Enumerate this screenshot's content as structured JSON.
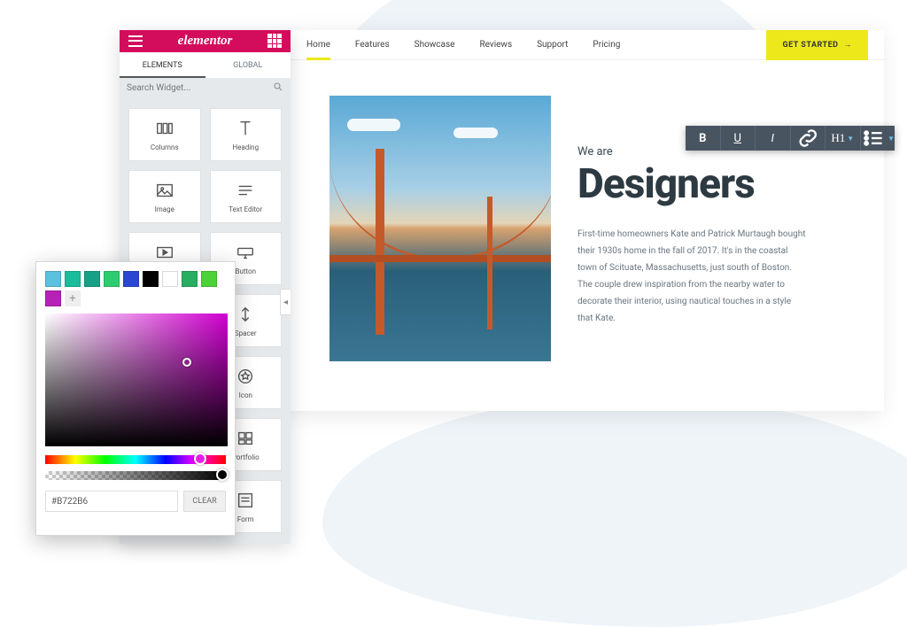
{
  "panel": {
    "brand": "elementor",
    "tabs": {
      "elements": "ELEMENTS",
      "global": "GLOBAL"
    },
    "search": {
      "placeholder": "Search Widget..."
    },
    "widgets": [
      {
        "key": "columns",
        "label": "Columns"
      },
      {
        "key": "heading",
        "label": "Heading"
      },
      {
        "key": "image",
        "label": "Image"
      },
      {
        "key": "text-editor",
        "label": "Text Editor"
      },
      {
        "key": "video",
        "label": "Video"
      },
      {
        "key": "button",
        "label": "Button"
      },
      {
        "key": "spacer",
        "label": "Spacer"
      },
      {
        "key": "icon",
        "label": "Icon"
      },
      {
        "key": "portfolio",
        "label": "Portfolio"
      },
      {
        "key": "form",
        "label": "Form"
      }
    ]
  },
  "preview": {
    "nav": [
      "Home",
      "Features",
      "Showcase",
      "Reviews",
      "Support",
      "Pricing"
    ],
    "cta": "GET STARTED",
    "subheading": "We are",
    "heading": "Designers",
    "paragraph": "First-time homeowners Kate and Patrick Murtaugh bought their 1930s home in the fall of 2017. It's in the coastal town of Scituate, Massachusetts, just south of Boston. The couple drew inspiration from the nearby water to decorate their interior, using nautical touches in a style that Kate."
  },
  "toolbar": {
    "bold": "B",
    "underline": "U",
    "italic": "I",
    "link": "link",
    "heading": "H1",
    "list": "list"
  },
  "picker": {
    "swatches": [
      "#5bc0de",
      "#1abc9c",
      "#16a085",
      "#2ecc71",
      "#2947d1",
      "#000000",
      "#ffffff",
      "#27ae60",
      "#4cd137",
      "#b722b6"
    ],
    "hex": "#B722B6",
    "clear": "CLEAR"
  }
}
